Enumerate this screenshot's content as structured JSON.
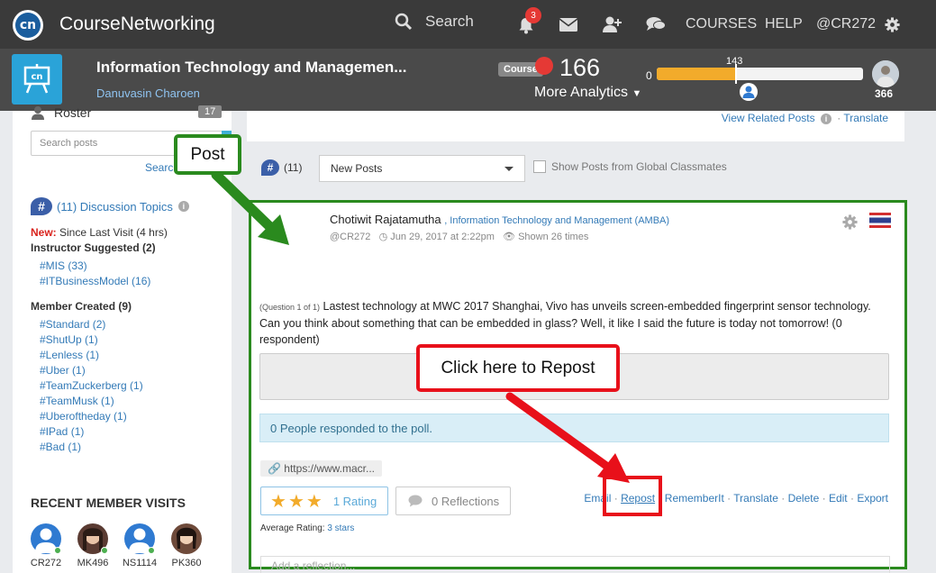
{
  "topbar": {
    "brand": "CourseNetworking",
    "logo_text": "cn",
    "search_label": "Search",
    "notification_count": "3",
    "courses_label": "COURSES",
    "help_label": "HELP",
    "user_handle": "@CR272",
    "icons": [
      "search-icon",
      "bell-icon",
      "mail-icon",
      "add-user-icon",
      "chat-icon",
      "gear-icon"
    ]
  },
  "course": {
    "title": "Information Technology and Managemen...",
    "owner": "Danuvasin Charoen",
    "badge": "Course",
    "score": "166",
    "more_analytics": "More Analytics",
    "progress_min": "0",
    "progress_marker": "143",
    "progress_max": "366",
    "progress_fraction": 0.39
  },
  "sidebar": {
    "roster_label": "Roster",
    "roster_count": "17",
    "search_placeholder": "Search posts",
    "search_link": "Search",
    "discussion_topics": "(11) Discussion Topics",
    "new_label": "New:",
    "since_visit": "Since Last Visit (4 hrs)",
    "instructor_heading": "Instructor Suggested (2)",
    "instructor_tags": [
      "#MIS (33)",
      "#ITBusinessModel (16)"
    ],
    "member_heading": "Member Created (9)",
    "member_tags": [
      "#Standard (2)",
      "#ShutUp (1)",
      "#Lenless (1)",
      "#Uber (1)",
      "#TeamZuckerberg (1)",
      "#TeamMusk (1)",
      "#Uberoftheday (1)",
      "#IPad (1)",
      "#Bad (1)"
    ],
    "recent_heading": "RECENT MEMBER VISITS",
    "visits": [
      "CR272",
      "MK496",
      "NS1114",
      "PK360"
    ]
  },
  "main": {
    "related_link": "View Related Posts",
    "translate_link": "Translate",
    "topic_count": "(11)",
    "filter_value": "New Posts",
    "global_check_label": "Show Posts from Global Classmates"
  },
  "post": {
    "author": "Chotiwit Rajatamutha",
    "course_link": ", Information Technology and Management (AMBA)",
    "handle": "@CR272",
    "date": "Jun 29, 2017 at 2:22pm",
    "shown": "Shown 26 times",
    "question_number": "(Question 1 of 1)",
    "question_text": "Lastest technology at MWC 2017 Shanghai, Vivo has unveils screen-embedded fingerprint sensor technology. Can you think about something that can be embedded in glass? Well, it like I said the future is today not tomorrow! (0 respondent)",
    "poll_note": "0 People responded to the poll.",
    "link_preview": "https://www.macr...",
    "rating_label": "1 Rating",
    "rating_stars": 3,
    "reflections_label": "0 Reflections",
    "actions": [
      "Email",
      "Repost",
      "RememberIt",
      "Translate",
      "Delete",
      "Edit",
      "Export"
    ],
    "avg_label": "Average Rating:",
    "avg_value": "3 stars",
    "reflection_placeholder": "Add a reflection..."
  },
  "annotations": {
    "post_label": "Post",
    "repost_label": "Click here to Repost",
    "green": "#2a8a1e",
    "red": "#e8101a"
  }
}
